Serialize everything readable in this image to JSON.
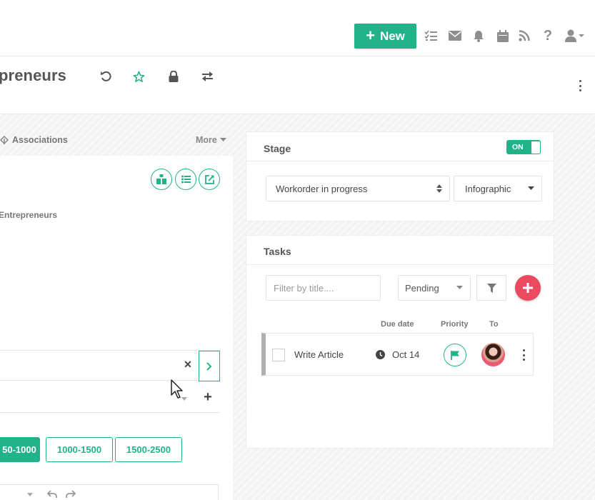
{
  "header": {
    "new_button_label": "New",
    "icons": [
      "tasks-icon",
      "mail-icon",
      "bell-icon",
      "calendar-icon",
      "rss-icon",
      "help-icon",
      "user-icon"
    ]
  },
  "titlebar": {
    "title": "preneurs",
    "icons": [
      "undo-icon",
      "star-icon",
      "lock-icon",
      "swap-icon"
    ]
  },
  "left": {
    "associations_label": "Associations",
    "more_label": "More",
    "entrepreneurs_label": "Entrepreneurs",
    "ranges": [
      "50-1000",
      "1000-1500",
      "1500-2500"
    ]
  },
  "stage": {
    "title": "Stage",
    "toggle_label": "ON",
    "stage_value": "Workorder in progress",
    "view_value": "Infographic"
  },
  "tasks": {
    "title": "Tasks",
    "filter_placeholder": "Filter by title....",
    "status_value": "Pending",
    "columns": {
      "due": "Due date",
      "priority": "Priority",
      "to": "To"
    },
    "items": [
      {
        "title": "Write Article",
        "due": "Oct 14"
      }
    ]
  },
  "colors": {
    "accent": "#21b28a",
    "danger": "#e94a5f"
  }
}
